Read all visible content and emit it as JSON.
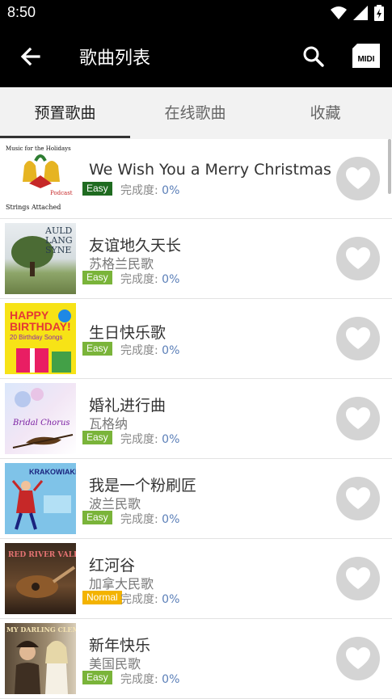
{
  "status_bar": {
    "time": "8:50"
  },
  "toolbar": {
    "title": "歌曲列表",
    "midi_label": "MIDI"
  },
  "tabs": [
    {
      "label": "预置歌曲",
      "active": true
    },
    {
      "label": "在线歌曲",
      "active": false
    },
    {
      "label": "收藏",
      "active": false
    }
  ],
  "progress_label": "完成度:",
  "songs": [
    {
      "title": "We Wish You a Merry Christmas",
      "artist": "",
      "level": "Easy",
      "progress": "0%",
      "cover": {
        "top": "Music for the Holidays",
        "mid": "Podcast",
        "bottom": "Strings Attached"
      }
    },
    {
      "title": "友谊地久天长",
      "artist": "苏格兰民歌",
      "level": "Easy",
      "progress": "0%",
      "cover": {
        "top": "AULD LANG SYNE"
      }
    },
    {
      "title": "生日快乐歌",
      "artist": "",
      "level": "Easy",
      "progress": "0%",
      "cover": {
        "top": "HAPPY BIRTHDAY!",
        "bottom": "20 Birthday Songs"
      }
    },
    {
      "title": "婚礼进行曲",
      "artist": "瓦格纳",
      "level": "Easy",
      "progress": "0%",
      "cover": {
        "top": "Bridal Chorus"
      }
    },
    {
      "title": "我是一个粉刷匠",
      "artist": "波兰民歌",
      "level": "Easy",
      "progress": "0%",
      "cover": {
        "top": "KRAKOWIAKI"
      }
    },
    {
      "title": "红河谷",
      "artist": "加拿大民歌",
      "level": "Normal",
      "progress": "0%",
      "cover": {
        "top": "RED RIVER VALLEY"
      }
    },
    {
      "title": "新年快乐",
      "artist": "美国民歌",
      "level": "Easy",
      "progress": "0%",
      "cover": {
        "top": "MY DARLING CLEMENTINE"
      }
    }
  ]
}
